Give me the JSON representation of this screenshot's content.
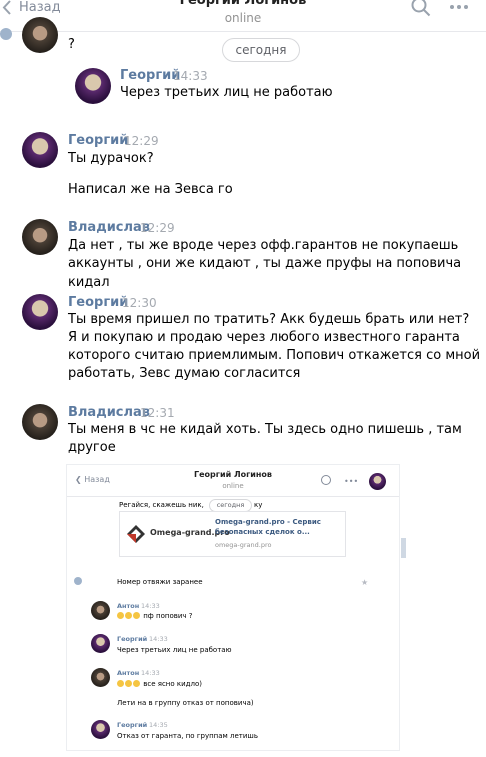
{
  "header": {
    "back_label": "Назад",
    "title": "Георгий Логинов",
    "status": "online",
    "search_icon": "search-icon",
    "more_icon": "more-icon"
  },
  "chat": {
    "prev_message_text": "?",
    "date_divider": "сегодня",
    "messages": [
      {
        "author": "Георгий",
        "time": "14:33",
        "lines": [
          "Через третьих лиц не работаю"
        ]
      },
      {
        "author": "Георгий",
        "time": "12:29",
        "lines": [
          "Ты дурачок?",
          "Написал же на Зевса го"
        ]
      },
      {
        "author": "Владислав",
        "time": "12:29",
        "lines": [
          "Да нет , ты же вроде через офф.гарантов не покупаешь",
          "аккаунты , они же кидают , ты даже пруфы на поповича кидал"
        ]
      },
      {
        "author": "Георгий",
        "time": "12:30",
        "lines": [
          "Ты время пришел по тратить? Акк будешь брать или нет?",
          "Я и покупаю и продаю через любого известного гаранта",
          "которого считаю приемлимым. Попович откажется со мной",
          "работать, Зевс думаю согласится"
        ]
      },
      {
        "author": "Владислав",
        "time": "12:31",
        "lines": [
          "Ты меня в чс не кидай хоть. Ты здесь одно пишешь , там",
          "другое"
        ]
      }
    ]
  },
  "attachment": {
    "back_label": "Назад",
    "title": "Георгий Логинов",
    "status": "online",
    "snippet_left": "Регайся, скажешь ник,",
    "snippet_right": "ку",
    "date_divider": "сегодня",
    "link_card": {
      "logo_text": "Omega-grand.pro",
      "title_line1": "Omega-grand.pro - Сервис",
      "title_line2": "безопасных сделок о...",
      "url": "omega-grand.pro"
    },
    "pending_text": "Номер отвяжи заранее",
    "messages": [
      {
        "author": "Антон",
        "time": "14:33",
        "text": "пф попович ?"
      },
      {
        "author": "Георгий",
        "time": "14:33",
        "text": "Через третьих лиц не работаю"
      },
      {
        "author": "Антон",
        "time": "14:33",
        "text": "все ясно кидло)",
        "extra": "Лети на в группу отказ от поповича)"
      },
      {
        "author": "Георгий",
        "time": "14:35",
        "text": "Отказ от гаранта, по группам летишь"
      }
    ]
  }
}
